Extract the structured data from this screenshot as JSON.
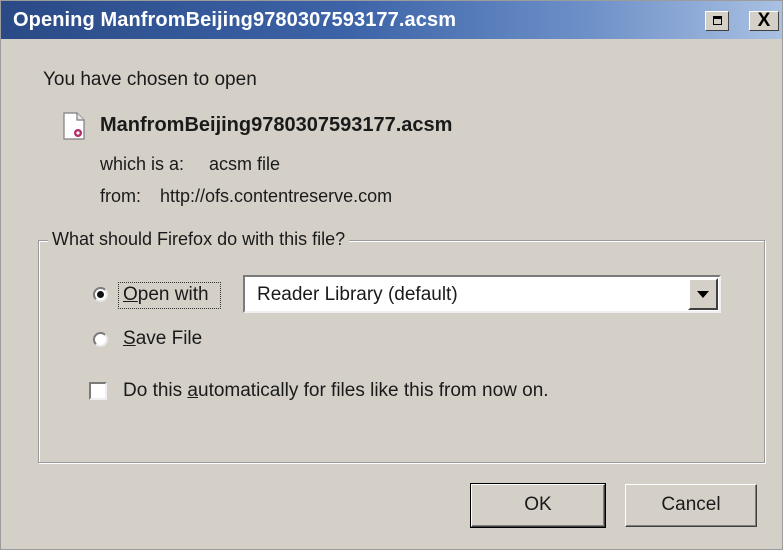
{
  "window": {
    "title": "Opening ManfromBeijing9780307593177.acsm",
    "restore_icon": "restore-icon",
    "close_glyph": "X"
  },
  "intro_text": "You have chosen to open",
  "file": {
    "icon": "acsm-file-icon",
    "name": "ManfromBeijing9780307593177.acsm",
    "type_label": "which is a:",
    "type_value": "acsm file",
    "from_label": "from:",
    "from_value": "http://ofs.contentreserve.com"
  },
  "action_group": {
    "legend": "What should Firefox do with this file?",
    "open_with": {
      "label_accel": "O",
      "label_rest": "pen with",
      "selected": true
    },
    "application_select": {
      "value": "Reader Library (default)"
    },
    "save_file": {
      "label_accel": "S",
      "label_rest": "ave File",
      "selected": false
    },
    "auto_checkbox": {
      "label_before": "Do this ",
      "label_accel": "a",
      "label_after": "utomatically for files like this from now on.",
      "checked": false
    }
  },
  "buttons": {
    "ok": "OK",
    "cancel": "Cancel"
  }
}
